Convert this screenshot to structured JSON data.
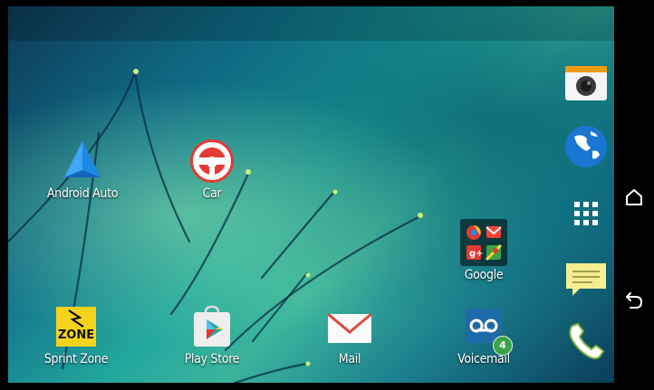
{
  "home_apps": [
    {
      "label": "Android Auto",
      "icon": "android-auto-icon"
    },
    {
      "label": "Car",
      "icon": "car-steering-wheel-icon"
    },
    {
      "label": "Google",
      "icon": "google-folder-icon"
    }
  ],
  "bottom_apps": [
    {
      "label": "Sprint Zone",
      "icon": "sprint-zone-icon",
      "icon_text": "ZONE"
    },
    {
      "label": "Play Store",
      "icon": "play-store-icon"
    },
    {
      "label": "Mail",
      "icon": "mail-icon"
    },
    {
      "label": "Voicemail",
      "icon": "voicemail-icon",
      "badge": "4"
    }
  ],
  "dock": [
    {
      "icon": "camera-icon"
    },
    {
      "icon": "browser-globe-icon"
    },
    {
      "icon": "app-drawer-icon"
    },
    {
      "icon": "messages-icon"
    },
    {
      "icon": "phone-icon"
    }
  ],
  "navbar": [
    {
      "icon": "home-icon"
    },
    {
      "icon": "back-icon"
    }
  ],
  "colors": {
    "accent_green": "#3aa346",
    "sprint_yellow": "#f5d31c",
    "mail_red": "#d84b3e"
  }
}
